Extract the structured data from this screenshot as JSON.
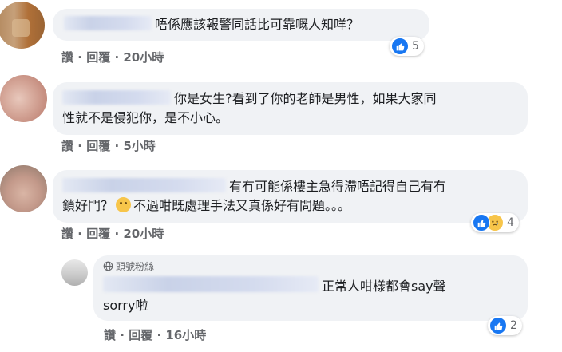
{
  "actions": {
    "like": "讚",
    "separator": "·",
    "reply": "回覆"
  },
  "comments": [
    {
      "text": "唔係應該報警同話比可靠嘅人知咩？",
      "time": "20小時",
      "reactions": {
        "types": [
          "like-icon"
        ],
        "count": "5"
      }
    },
    {
      "text_line1": "你是女生?看到了你的老師是男性，如果大家同",
      "text_line2": "性就不是侵犯你，是不小心。",
      "time": "5小時"
    },
    {
      "text_line1a": "有冇可能係樓主急得滯唔記得自己有冇",
      "text_line2a": "鎖好門？",
      "text_line2b": "不過咁既處理手法又真係好有問題。。。",
      "time": "20小時",
      "reactions": {
        "types": [
          "like-icon",
          "sad-icon"
        ],
        "count": "4"
      }
    },
    {
      "badge": "頭號粉絲",
      "text_line1": "正常人咁樣都會say聲",
      "text_line2": "sorry啦",
      "time": "16小時",
      "reactions": {
        "types": [
          "like-icon"
        ],
        "count": "2"
      }
    }
  ],
  "colors": {
    "bubble": "#f0f2f5",
    "meta_text": "#65676b",
    "like_blue": "#1877f2"
  }
}
